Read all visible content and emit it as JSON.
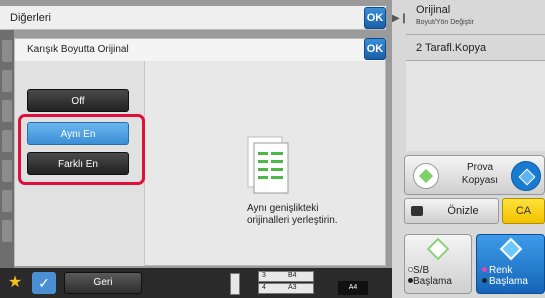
{
  "background_dialog": {
    "title": "Diğerleri",
    "ok_label": "OK"
  },
  "dialog": {
    "title": "Karışık Boyutta Orijinal",
    "ok_label": "OK",
    "options": [
      {
        "label": "Off",
        "selected": false
      },
      {
        "label": "Aynı En",
        "selected": true
      },
      {
        "label": "Farklı En",
        "selected": false
      }
    ],
    "description_line1": "Aynı genişlikteki",
    "description_line2": "orijinalleri yerleştirin."
  },
  "right_panel": {
    "original_label": "Orijinal",
    "original_sub": "Boyut/Yön Değiştir",
    "duplex_label": "2 Tarafl.Kopya",
    "proof_copy_line1": "Prova",
    "proof_copy_line2": "Kopyası",
    "preview_label": "Önizle",
    "ca_label": "CA",
    "bw_line1": "S/B",
    "bw_line2": "Başlama",
    "color_line1": "Renk",
    "color_line2": "Başlama"
  },
  "bottom_bar": {
    "back_label": "Geri",
    "trays": [
      {
        "number": "3",
        "size": "B4"
      },
      {
        "number": "4",
        "size": "A3"
      }
    ],
    "selected_size": "A4"
  },
  "colors": {
    "accent_blue": "#3b8fd6",
    "highlight_red": "#e0103a",
    "ca_yellow": "#f2c200",
    "color_start_blue": "#1565b8"
  }
}
